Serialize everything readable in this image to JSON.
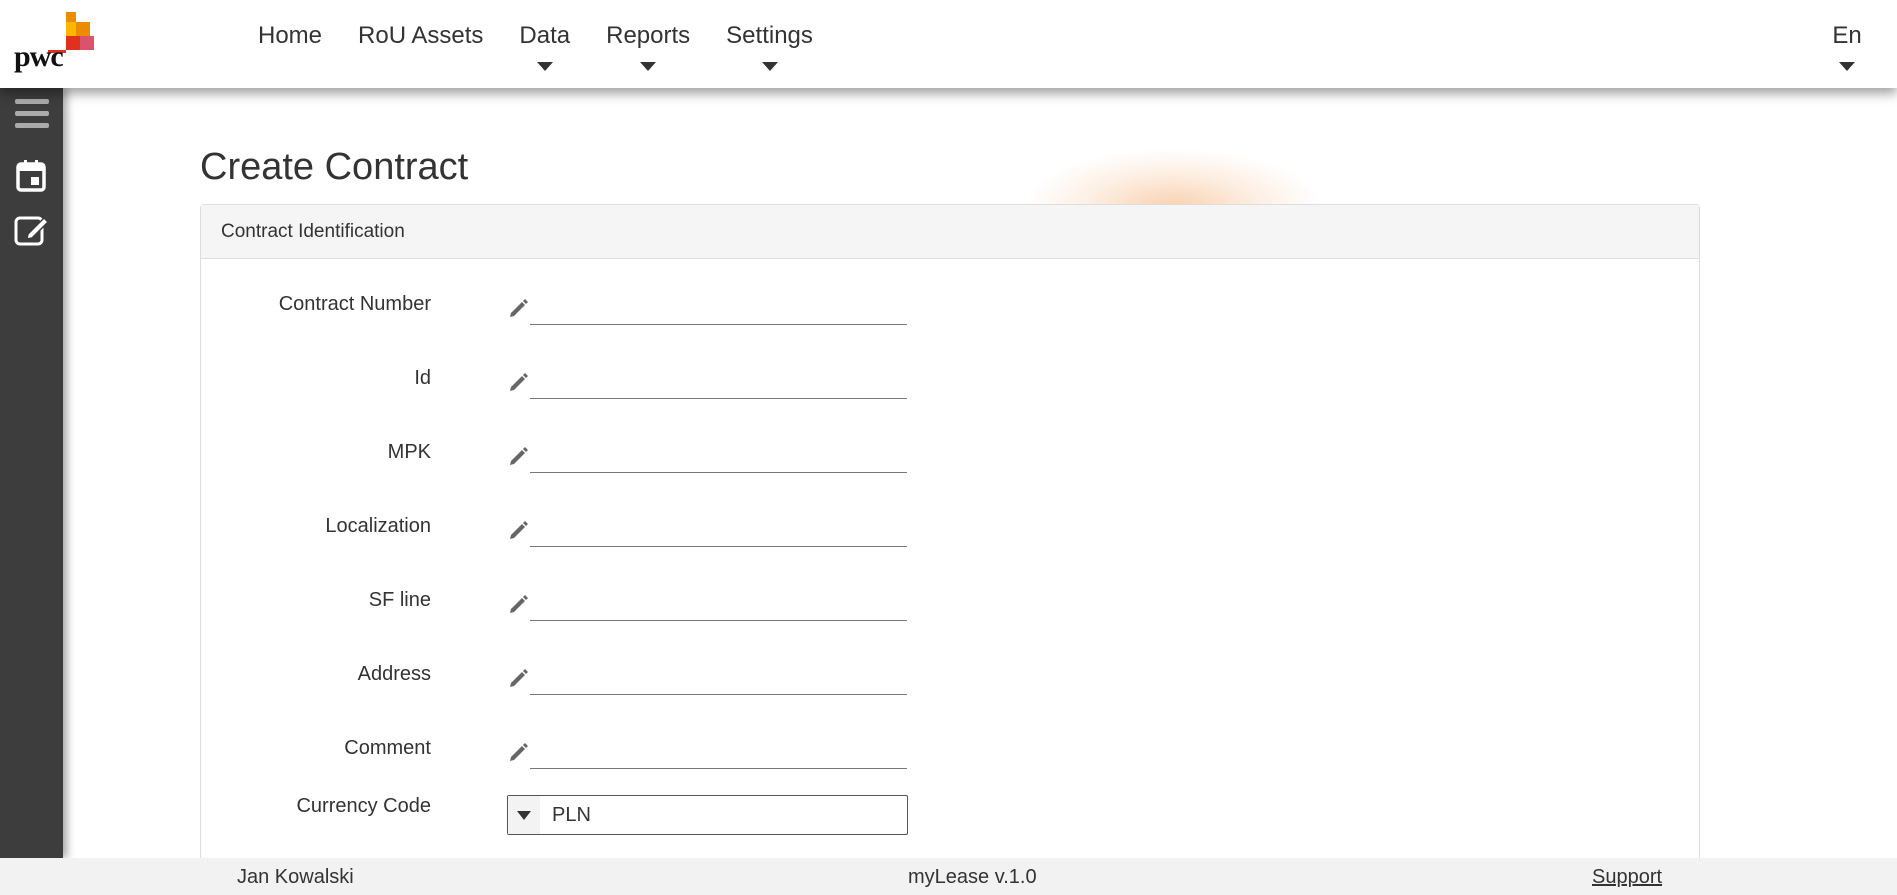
{
  "brand": {
    "logo_text": "pwc",
    "colors": {
      "orange": "#e0301e",
      "amber": "#eb8c00",
      "yellow": "#ffb600",
      "rose": "#db536a",
      "dark": "#3d3d3d"
    }
  },
  "nav": {
    "items": [
      {
        "label": "Home",
        "has_dropdown": false
      },
      {
        "label": "RoU Assets",
        "has_dropdown": false
      },
      {
        "label": "Data",
        "has_dropdown": true
      },
      {
        "label": "Reports",
        "has_dropdown": true
      },
      {
        "label": "Settings",
        "has_dropdown": true
      }
    ],
    "language": "En"
  },
  "sidebar": {
    "icons": [
      "menu-icon",
      "calendar-icon",
      "edit-icon"
    ]
  },
  "page": {
    "title": "Create Contract",
    "panel_title": "Contract Identification",
    "fields": [
      {
        "label": "Contract Number",
        "value": ""
      },
      {
        "label": "Id",
        "value": ""
      },
      {
        "label": "MPK",
        "value": ""
      },
      {
        "label": "Localization",
        "value": ""
      },
      {
        "label": "SF line",
        "value": ""
      },
      {
        "label": "Address",
        "value": ""
      },
      {
        "label": "Comment",
        "value": ""
      }
    ],
    "currency": {
      "label": "Currency Code",
      "value": "PLN"
    }
  },
  "footer": {
    "user": "Jan Kowalski",
    "version": "myLease v.1.0",
    "support": "Support"
  }
}
